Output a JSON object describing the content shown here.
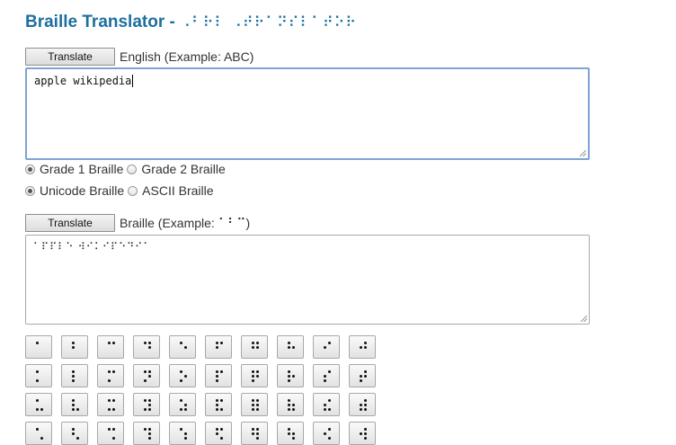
{
  "page": {
    "title": "Braille Translator - ",
    "title_braille": "⠠⠃⠗⠇ ⠠⠞⠗⠁⠝⠎⠇⠁⠞⠕⠗"
  },
  "english_section": {
    "button_label": "Translate",
    "label": "English (Example: ABC)",
    "text_value": "apple wikipedia"
  },
  "grade_options": [
    {
      "label": "Grade 1 Braille",
      "checked": true
    },
    {
      "label": "Grade 2 Braille",
      "checked": false
    }
  ],
  "format_options": [
    {
      "label": "Unicode Braille",
      "checked": true
    },
    {
      "label": "ASCII Braille",
      "checked": false
    }
  ],
  "braille_section": {
    "button_label": "Translate",
    "label_prefix": "Braille (Example: ",
    "label_example": "⠁⠃⠉",
    "label_suffix": ")",
    "text_value": "⠁⠏⠏⠇⠑ ⠺⠊⠅⠊⠏⠑⠙⠊⠁"
  },
  "keypad": {
    "rows": [
      [
        "⠁",
        "⠃",
        "⠉",
        "⠙",
        "⠑",
        "⠋",
        "⠛",
        "⠓",
        "⠊",
        "⠚"
      ],
      [
        "⠅",
        "⠇",
        "⠍",
        "⠝",
        "⠕",
        "⠏",
        "⠟",
        "⠗",
        "⠎",
        "⠞"
      ],
      [
        "⠥",
        "⠧",
        "⠭",
        "⠽",
        "⠵",
        "⠯",
        "⠿",
        "⠷",
        "⠮",
        "⠾"
      ],
      [
        "⠡",
        "⠣",
        "⠩",
        "⠹",
        "⠱",
        "⠫",
        "⠻",
        "⠳",
        "⠪",
        "⠺"
      ]
    ]
  }
}
